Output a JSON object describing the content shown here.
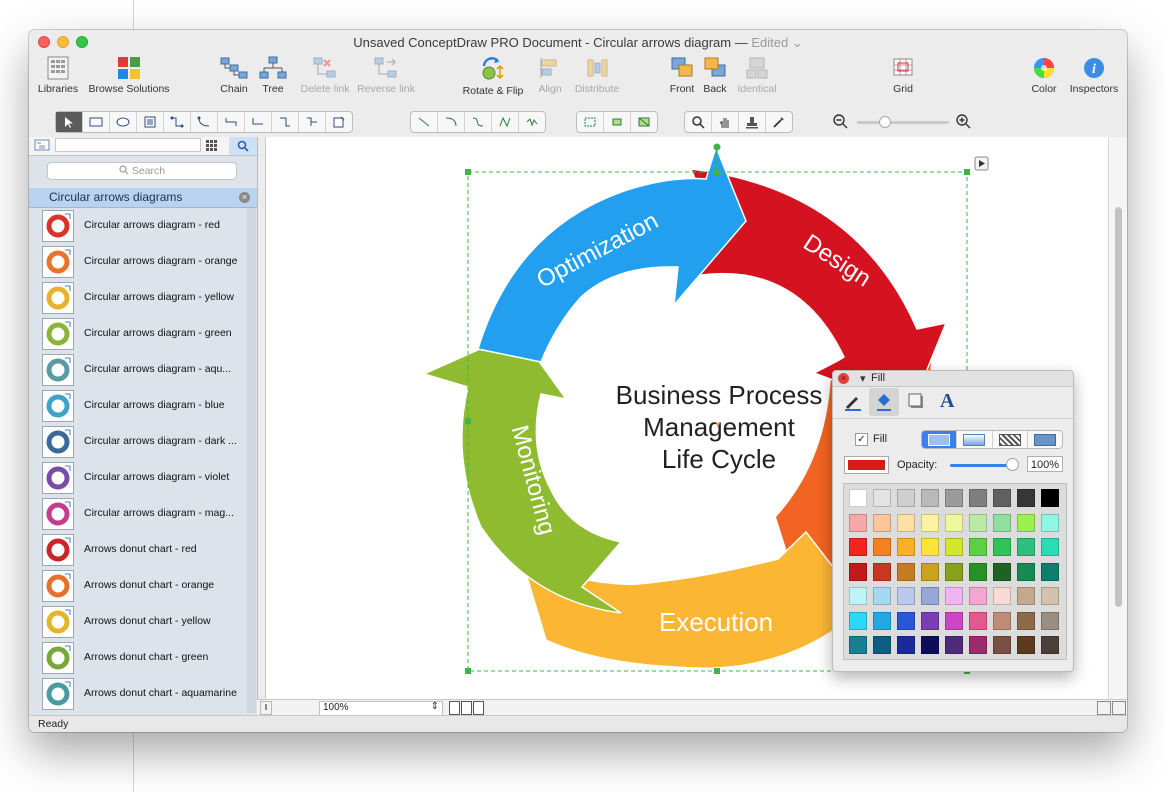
{
  "window": {
    "title": "Unsaved ConceptDraw PRO Document - Circular arrows diagram —",
    "edited": "Edited"
  },
  "toolbar": {
    "buttons": [
      {
        "label": "Libraries",
        "icon": "libraries-icon",
        "enabled": true
      },
      {
        "label": "Browse Solutions",
        "icon": "browse-solutions-icon",
        "enabled": true
      },
      {
        "label": "Chain",
        "icon": "chain-icon",
        "enabled": true
      },
      {
        "label": "Tree",
        "icon": "tree-icon",
        "enabled": true
      },
      {
        "label": "Delete link",
        "icon": "delete-link-icon",
        "enabled": false
      },
      {
        "label": "Reverse link",
        "icon": "reverse-link-icon",
        "enabled": false
      },
      {
        "label": "Rotate & Flip",
        "icon": "rotate-flip-icon",
        "enabled": true
      },
      {
        "label": "Align",
        "icon": "align-icon",
        "enabled": false
      },
      {
        "label": "Distribute",
        "icon": "distribute-icon",
        "enabled": false
      },
      {
        "label": "Front",
        "icon": "front-icon",
        "enabled": true
      },
      {
        "label": "Back",
        "icon": "back-icon",
        "enabled": true
      },
      {
        "label": "Identical",
        "icon": "identical-icon",
        "enabled": false
      },
      {
        "label": "Grid",
        "icon": "grid-icon",
        "enabled": true
      },
      {
        "label": "Color",
        "icon": "color-wheel-icon",
        "enabled": true
      },
      {
        "label": "Inspectors",
        "icon": "inspectors-icon",
        "enabled": true
      }
    ]
  },
  "library": {
    "search_placeholder": "Search",
    "title": "Circular arrows diagrams",
    "items": [
      {
        "label": "Circular arrows diagram - red",
        "color": "#d9332a"
      },
      {
        "label": "Circular arrows diagram - orange",
        "color": "#e8742c"
      },
      {
        "label": "Circular arrows diagram - yellow",
        "color": "#e8b22e"
      },
      {
        "label": "Circular arrows diagram - green",
        "color": "#8bb43a"
      },
      {
        "label": "Circular arrows diagram - aqu...",
        "color": "#5a9aa3"
      },
      {
        "label": "Circular arrows diagram - blue",
        "color": "#3fa3c9"
      },
      {
        "label": "Circular arrows diagram - dark ...",
        "color": "#3b6a9a"
      },
      {
        "label": "Circular arrows diagram - violet",
        "color": "#7a4aa8"
      },
      {
        "label": "Circular arrows diagram - mag...",
        "color": "#c43c8a"
      },
      {
        "label": "Arrows donut chart - red",
        "color": "#c9252a"
      },
      {
        "label": "Arrows donut chart - orange",
        "color": "#e5712a"
      },
      {
        "label": "Arrows donut chart - yellow",
        "color": "#e3b52c"
      },
      {
        "label": "Arrows donut chart - green",
        "color": "#78a83a"
      },
      {
        "label": "Arrows donut chart - aquamarine",
        "color": "#4a9aa0"
      }
    ]
  },
  "diagram": {
    "center_lines": [
      "Business Process",
      "Management",
      "Life Cycle"
    ],
    "segments": [
      {
        "label": "Design",
        "color": "#d5121f"
      },
      {
        "label": "Execution",
        "color": "#fbb634"
      },
      {
        "label": "Monitoring",
        "color": "#8ebb2f"
      },
      {
        "label": "Optimization",
        "color": "#22a0ef"
      }
    ],
    "hidden_segment_color": "#f26422"
  },
  "fill_panel": {
    "title": "Fill",
    "fill_label": "Fill",
    "fill_checked": true,
    "opacity_label": "Opacity:",
    "opacity_value": "100%",
    "current_color": "#d21c1c",
    "palette": [
      [
        "#ffffff",
        "#e3e3e3",
        "#cfcfcf",
        "#b9b9b9",
        "#9b9b9b",
        "#7f7f7f",
        "#606060",
        "#363636",
        "#000000"
      ],
      [
        "#f5a9a6",
        "#fbc59b",
        "#fde0a4",
        "#fbf3a0",
        "#eef79c",
        "#b9eba6",
        "#8fdf9e",
        "#9bef4e",
        "#8ff6e4"
      ],
      [
        "#ef2620",
        "#f58020",
        "#fbb127",
        "#fbe43a",
        "#d3e72f",
        "#5ccf43",
        "#2fc35a",
        "#2cbf7e",
        "#2ddbb7"
      ],
      [
        "#c11a1b",
        "#c6391f",
        "#c57c20",
        "#c9a21f",
        "#88a11c",
        "#279125",
        "#1e6321",
        "#168a52",
        "#0d7f6c"
      ],
      [
        "#bff3f6",
        "#a7d8f3",
        "#bac8ed",
        "#98a8d6",
        "#f0b4f0",
        "#f4a6d2",
        "#f7dad4",
        "#c4a88c",
        "#d3c3ad"
      ],
      [
        "#2bd8f6",
        "#24a8e2",
        "#2a56d8",
        "#7a3eb3",
        "#cc45c4",
        "#e25a8c",
        "#c08c78",
        "#8b6b4a",
        "#9a8e80"
      ],
      [
        "#197f93",
        "#0c5f83",
        "#1b2a9b",
        "#100c5d",
        "#4d2a7a",
        "#9b2b6a",
        "#7a5044",
        "#5a3b1e",
        "#4b3f3a"
      ]
    ]
  },
  "status": {
    "text": "Ready",
    "zoom": "100%"
  }
}
